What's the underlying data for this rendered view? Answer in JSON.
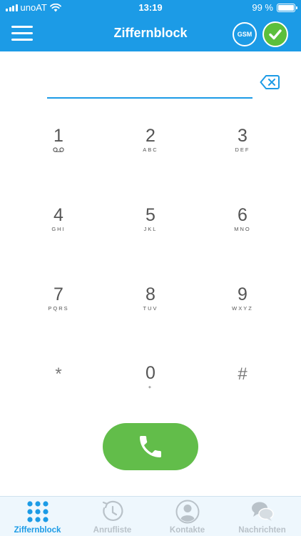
{
  "status_bar": {
    "carrier": "unoAT",
    "time": "13:19",
    "battery": "99 %",
    "battery_level": 0.99
  },
  "header": {
    "title": "Ziffernblock",
    "gsm_label": "GSM",
    "menu_icon": "hamburger-menu-icon",
    "confirm_icon": "checkmark-icon"
  },
  "number_field": {
    "value": "",
    "backspace_icon": "backspace-icon"
  },
  "keypad": {
    "keys": [
      {
        "digit": "1",
        "letters": "",
        "extra": "voicemail-icon"
      },
      {
        "digit": "2",
        "letters": "ABC"
      },
      {
        "digit": "3",
        "letters": "DEF"
      },
      {
        "digit": "4",
        "letters": "GHI"
      },
      {
        "digit": "5",
        "letters": "JKL"
      },
      {
        "digit": "6",
        "letters": "MNO"
      },
      {
        "digit": "7",
        "letters": "PQRS"
      },
      {
        "digit": "8",
        "letters": "TUV"
      },
      {
        "digit": "9",
        "letters": "WXYZ"
      },
      {
        "digit": "*",
        "letters": ""
      },
      {
        "digit": "0",
        "letters": "+"
      },
      {
        "digit": "#",
        "letters": ""
      }
    ]
  },
  "call_button": {
    "icon": "phone-icon"
  },
  "tabs": [
    {
      "label": "Ziffernblock",
      "icon": "keypad-grid-icon",
      "active": true
    },
    {
      "label": "Anrufliste",
      "icon": "clock-history-icon",
      "active": false
    },
    {
      "label": "Kontakte",
      "icon": "contact-person-icon",
      "active": false
    },
    {
      "label": "Nachrichten",
      "icon": "chat-bubbles-icon",
      "active": false
    }
  ],
  "colors": {
    "brand_blue": "#1c9be6",
    "call_green": "#62bd4a",
    "confirm_green": "#5cbf3c",
    "tab_inactive": "#b9c2c9"
  }
}
